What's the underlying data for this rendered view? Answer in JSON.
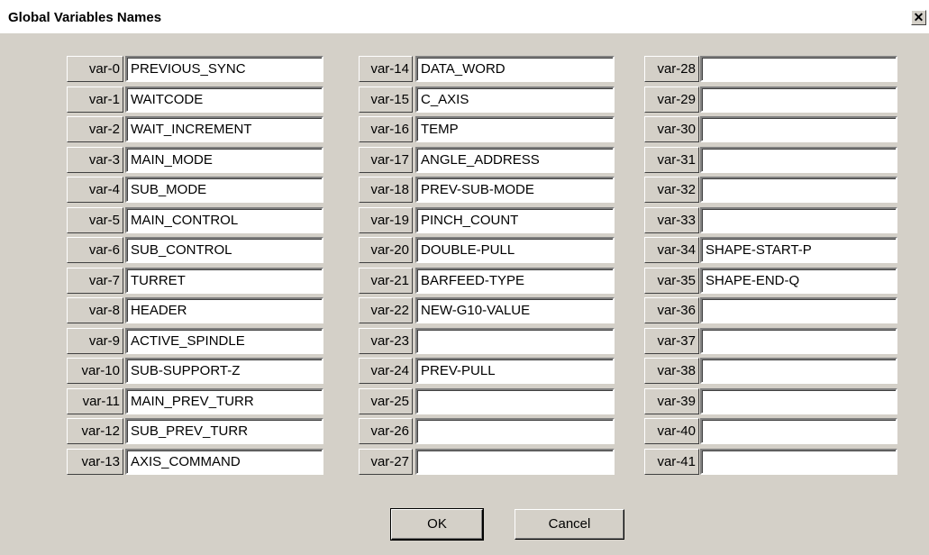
{
  "window": {
    "title": "Global Variables Names",
    "close_glyph": "✕"
  },
  "columns": [
    {
      "rows": [
        {
          "label": "var-0",
          "value": "PREVIOUS_SYNC"
        },
        {
          "label": "var-1",
          "value": "WAITCODE"
        },
        {
          "label": "var-2",
          "value": "WAIT_INCREMENT"
        },
        {
          "label": "var-3",
          "value": "MAIN_MODE"
        },
        {
          "label": "var-4",
          "value": "SUB_MODE"
        },
        {
          "label": "var-5",
          "value": "MAIN_CONTROL"
        },
        {
          "label": "var-6",
          "value": "SUB_CONTROL"
        },
        {
          "label": "var-7",
          "value": "TURRET"
        },
        {
          "label": "var-8",
          "value": "HEADER"
        },
        {
          "label": "var-9",
          "value": "ACTIVE_SPINDLE"
        },
        {
          "label": "var-10",
          "value": "SUB-SUPPORT-Z"
        },
        {
          "label": "var-11",
          "value": "MAIN_PREV_TURR"
        },
        {
          "label": "var-12",
          "value": "SUB_PREV_TURR"
        },
        {
          "label": "var-13",
          "value": "AXIS_COMMAND"
        }
      ]
    },
    {
      "rows": [
        {
          "label": "var-14",
          "value": "DATA_WORD"
        },
        {
          "label": "var-15",
          "value": "C_AXIS"
        },
        {
          "label": "var-16",
          "value": "TEMP"
        },
        {
          "label": "var-17",
          "value": "ANGLE_ADDRESS"
        },
        {
          "label": "var-18",
          "value": "PREV-SUB-MODE"
        },
        {
          "label": "var-19",
          "value": "PINCH_COUNT"
        },
        {
          "label": "var-20",
          "value": "DOUBLE-PULL"
        },
        {
          "label": "var-21",
          "value": "BARFEED-TYPE"
        },
        {
          "label": "var-22",
          "value": "NEW-G10-VALUE"
        },
        {
          "label": "var-23",
          "value": ""
        },
        {
          "label": "var-24",
          "value": "PREV-PULL"
        },
        {
          "label": "var-25",
          "value": ""
        },
        {
          "label": "var-26",
          "value": ""
        },
        {
          "label": "var-27",
          "value": ""
        }
      ]
    },
    {
      "rows": [
        {
          "label": "var-28",
          "value": ""
        },
        {
          "label": "var-29",
          "value": ""
        },
        {
          "label": "var-30",
          "value": ""
        },
        {
          "label": "var-31",
          "value": ""
        },
        {
          "label": "var-32",
          "value": ""
        },
        {
          "label": "var-33",
          "value": ""
        },
        {
          "label": "var-34",
          "value": "SHAPE-START-P"
        },
        {
          "label": "var-35",
          "value": "SHAPE-END-Q"
        },
        {
          "label": "var-36",
          "value": ""
        },
        {
          "label": "var-37",
          "value": ""
        },
        {
          "label": "var-38",
          "value": ""
        },
        {
          "label": "var-39",
          "value": ""
        },
        {
          "label": "var-40",
          "value": ""
        },
        {
          "label": "var-41",
          "value": ""
        }
      ]
    }
  ],
  "buttons": {
    "ok": "OK",
    "cancel": "Cancel"
  }
}
